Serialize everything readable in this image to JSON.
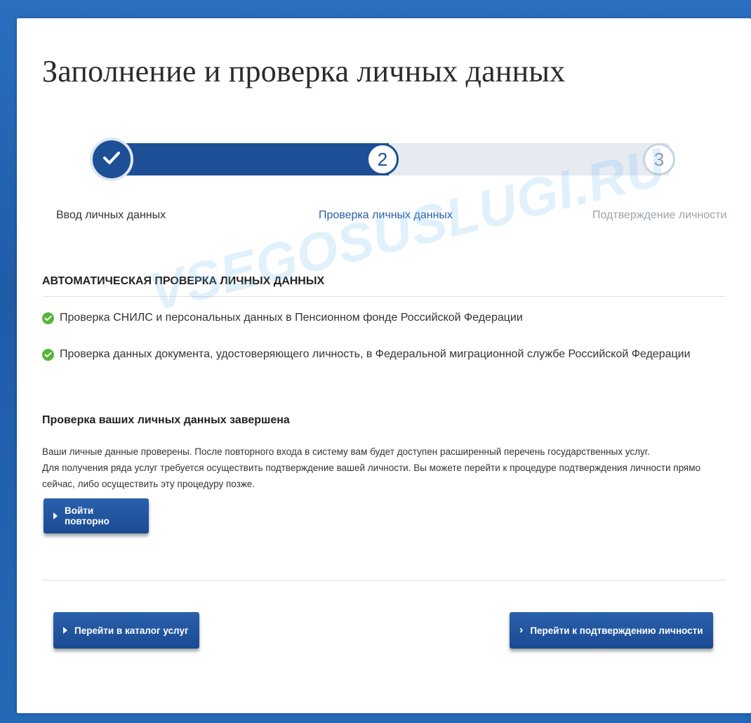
{
  "page": {
    "title": "Заполнение и проверка личных данных"
  },
  "stepper": {
    "progress_fraction": 0.5,
    "steps": [
      {
        "label": "Ввод личных данных",
        "marker": "",
        "state": "done",
        "icon": "check-icon"
      },
      {
        "label": "Проверка личных данных",
        "marker": "2",
        "state": "current"
      },
      {
        "label": "Подтверждение личности",
        "marker": "3",
        "state": "upcoming"
      }
    ]
  },
  "auto_check": {
    "heading": "Автоматическая проверка личных данных",
    "items": [
      {
        "text": "Проверка СНИЛС и персональных данных в Пенсионном фонде Российской Федерации",
        "status": "passed"
      },
      {
        "text": "Проверка данных документа, удостоверяющего личность, в Федеральной миграционной службе Российской Федерации",
        "status": "passed"
      }
    ]
  },
  "result": {
    "heading": "Проверка ваших личных данных завершена",
    "paragraph_1": "Ваши личные данные проверены. После повторного входа в систему вам будет доступен расширенный перечень государственных услуг.",
    "paragraph_2": "Для получения ряда услуг требуется осуществить подтверждение вашей личности. Вы можете перейти к процедуре подтверждения личности прямо сейчас, либо осуществить эту процедуру позже."
  },
  "buttons": {
    "relogin": "Войти повторно",
    "catalog": "Перейти в каталог услуг",
    "confirm_identity": "Перейти к подтверждению личности"
  },
  "watermark": "VSEGOSUSLUGI.RU",
  "colors": {
    "primary": "#1d4f96",
    "success": "#57b53c",
    "background": "#2468b6"
  }
}
